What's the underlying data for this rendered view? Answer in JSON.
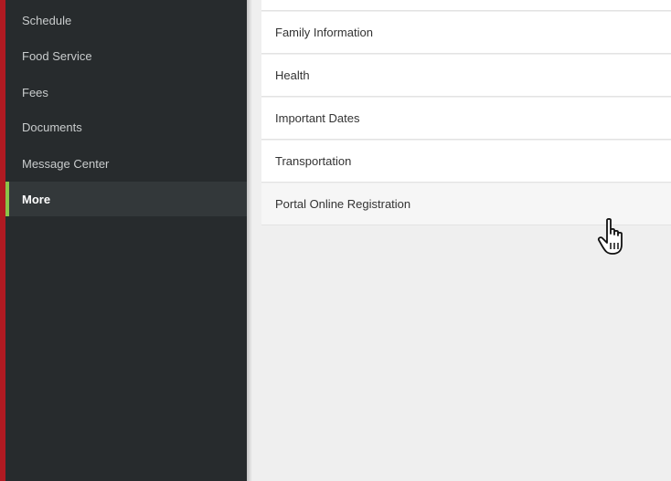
{
  "sidebar": {
    "items": [
      {
        "label": "Schedule"
      },
      {
        "label": "Food Service"
      },
      {
        "label": "Fees"
      },
      {
        "label": "Documents"
      },
      {
        "label": "Message Center"
      },
      {
        "label": "More",
        "active": true
      }
    ],
    "active_accent": "#8bc34a",
    "background": "#272b2d"
  },
  "main": {
    "items": [
      {
        "label": "Family Information"
      },
      {
        "label": "Health"
      },
      {
        "label": "Important Dates"
      },
      {
        "label": "Transportation"
      },
      {
        "label": "Portal Online Registration",
        "hovered": true
      }
    ]
  },
  "cursor": {
    "icon": "hand-pointer-icon"
  },
  "colors": {
    "brand_edge": "#b01a22",
    "content_bg": "#efefef"
  }
}
